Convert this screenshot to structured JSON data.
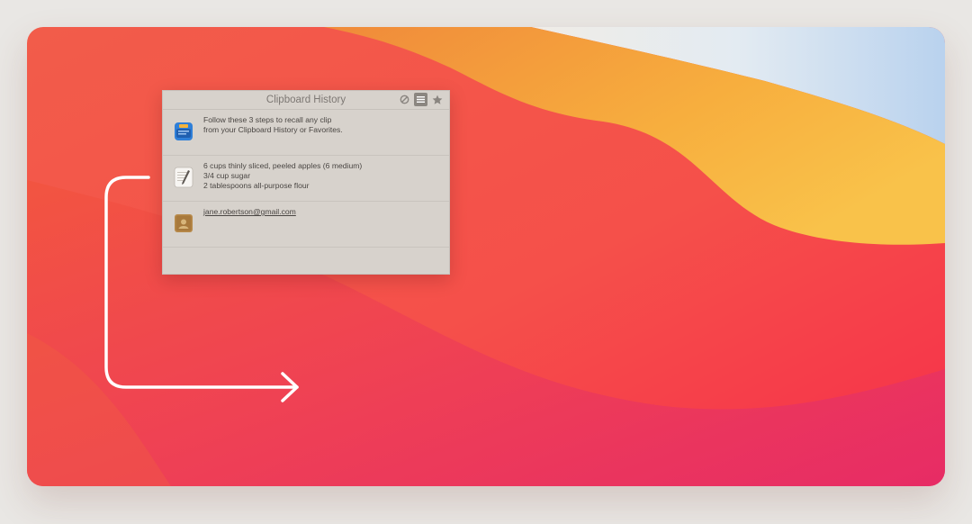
{
  "window": {
    "title": "Clipboard History"
  },
  "toolbar": {
    "buttons": [
      {
        "name": "clear",
        "icon": "clear-icon"
      },
      {
        "name": "history",
        "icon": "list-icon",
        "active": true
      },
      {
        "name": "favorites",
        "icon": "star-icon"
      }
    ]
  },
  "clips": [
    {
      "app_icon": "clipboard-app-icon",
      "lines": [
        "Follow these 3 steps to recall any clip",
        "from your Clipboard History or Favorites."
      ]
    },
    {
      "app_icon": "textedit-icon",
      "lines": [
        "6 cups thinly sliced, peeled apples (6 medium)",
        "3/4 cup sugar",
        "2 tablespoons all-purpose flour"
      ]
    },
    {
      "app_icon": "contacts-icon",
      "lines": [
        "jane.robertson@gmail.com"
      ],
      "is_link": true
    }
  ],
  "colors": {
    "panel": "#d7d2cc",
    "accent_button": "#8b8680",
    "wallpaper_red": "#f54a4a",
    "wallpaper_orange": "#f6a23c",
    "wallpaper_sky": "#d9e6f5"
  },
  "decoration": {
    "arrow": "arrow-right-icon"
  }
}
